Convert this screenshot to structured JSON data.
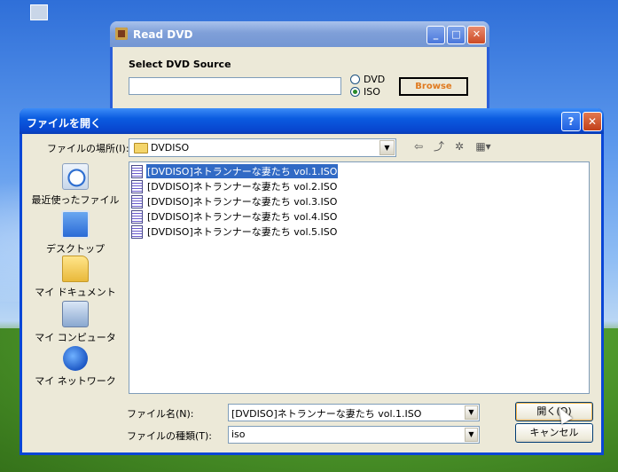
{
  "read_dvd": {
    "title": "Read DVD",
    "label": "Select DVD Source",
    "input_value": "",
    "radio_dvd": "DVD",
    "radio_iso": "ISO",
    "selected": "ISO",
    "browse": "Browse"
  },
  "dialog": {
    "title": "ファイルを開く",
    "help_btn": "?",
    "close_btn": "✕",
    "lookin_label": "ファイルの場所(I):",
    "lookin_value": "DVDISO",
    "places": [
      {
        "label": "最近使ったファイル",
        "icon": "recent-icon"
      },
      {
        "label": "デスクトップ",
        "icon": "desktop-icon"
      },
      {
        "label": "マイ ドキュメント",
        "icon": "my-documents-icon"
      },
      {
        "label": "マイ コンピュータ",
        "icon": "my-computer-icon"
      },
      {
        "label": "マイ ネットワーク",
        "icon": "network-icon"
      }
    ],
    "files": [
      "[DVDISO]ネトランナーな妻たち vol.1.ISO",
      "[DVDISO]ネトランナーな妻たち vol.2.ISO",
      "[DVDISO]ネトランナーな妻たち vol.3.ISO",
      "[DVDISO]ネトランナーな妻たち vol.4.ISO",
      "[DVDISO]ネトランナーな妻たち vol.5.ISO"
    ],
    "selected_file_index": 0,
    "filename_label": "ファイル名(N):",
    "filename_value": "[DVDISO]ネトランナーな妻たち vol.1.ISO",
    "filetype_label": "ファイルの種類(T):",
    "filetype_value": "iso",
    "open_btn": "開く(O)",
    "cancel_btn": "キャンセル"
  }
}
